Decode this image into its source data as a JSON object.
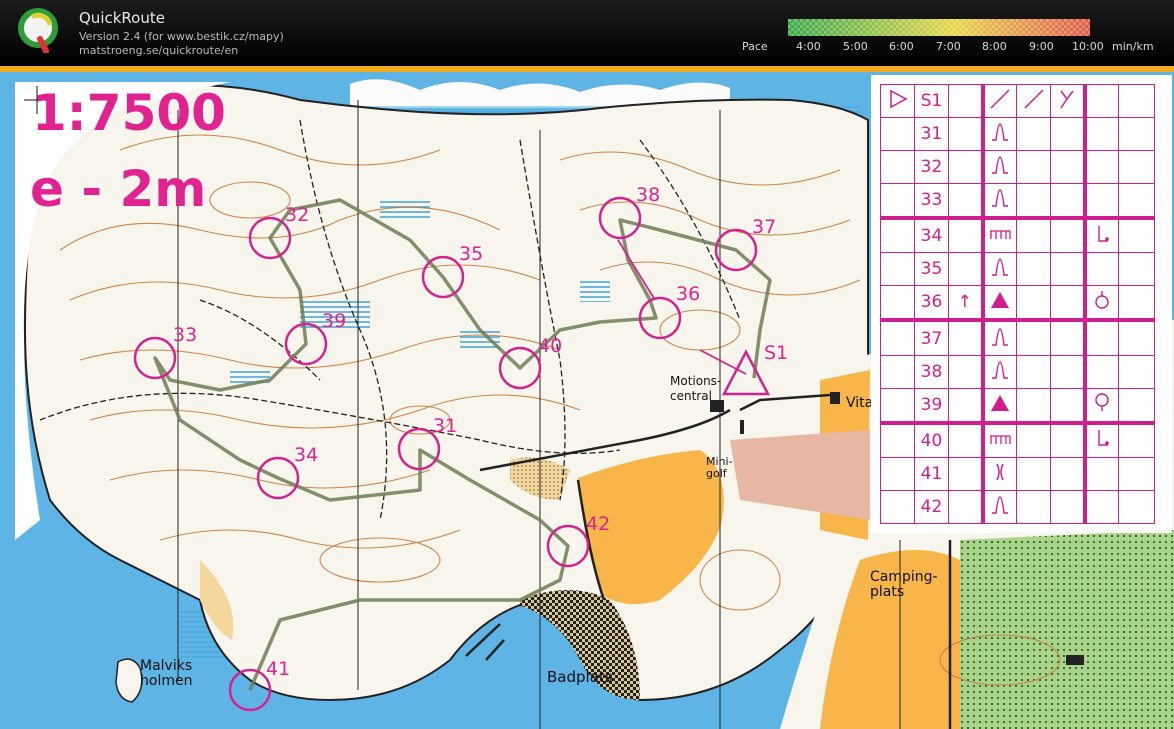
{
  "app": {
    "title": "QuickRoute",
    "version": "Version 2.4  (for www.bestik.cz/mapy)",
    "url": "matstroeng.se/quickroute/en"
  },
  "pace": {
    "label": "Pace",
    "ticks": [
      "4:00",
      "5:00",
      "6:00",
      "7:00",
      "8:00",
      "9:00",
      "10:00"
    ],
    "unit": "min/km",
    "colors": [
      "#3aa84a",
      "#e6d64a",
      "#e05a4a"
    ]
  },
  "map": {
    "scale": "1:7500",
    "contour_interval": "e - 2m",
    "labels": {
      "motionscentral": [
        "Motions-",
        "central"
      ],
      "vita": "Vita",
      "minigolf": [
        "Mini-",
        "golf"
      ],
      "campingplats": [
        "Camping-",
        "plats"
      ],
      "badplats": "Badplats",
      "malviksholmen": [
        "Malviks",
        "holmen"
      ]
    },
    "start_label": "S1",
    "controls": [
      {
        "n": "31"
      },
      {
        "n": "32"
      },
      {
        "n": "33"
      },
      {
        "n": "34"
      },
      {
        "n": "35"
      },
      {
        "n": "36"
      },
      {
        "n": "37"
      },
      {
        "n": "38"
      },
      {
        "n": "39"
      },
      {
        "n": "40"
      },
      {
        "n": "41"
      },
      {
        "n": "42"
      }
    ]
  },
  "descriptions": {
    "header": {
      "code": "S1"
    },
    "rows": [
      {
        "code": "31",
        "feature": "knoll-symbol"
      },
      {
        "code": "32",
        "feature": "knoll-symbol"
      },
      {
        "code": "33",
        "feature": "knoll-symbol"
      },
      {
        "code": "34",
        "feature": "fence-symbol",
        "position": "foot-symbol"
      },
      {
        "code": "35",
        "feature": "knoll-symbol"
      },
      {
        "code": "36",
        "direction": "↑",
        "feature": "boulder-symbol",
        "position": "top-symbol"
      },
      {
        "code": "37",
        "feature": "knoll-symbol"
      },
      {
        "code": "38",
        "feature": "knoll-symbol"
      },
      {
        "code": "39",
        "feature": "boulder-symbol",
        "position": "top-symbol"
      },
      {
        "code": "40",
        "feature": "fence-symbol",
        "position": "foot-symbol"
      },
      {
        "code": "41",
        "feature": "gully-symbol"
      },
      {
        "code": "42",
        "feature": "knoll-symbol"
      }
    ]
  }
}
